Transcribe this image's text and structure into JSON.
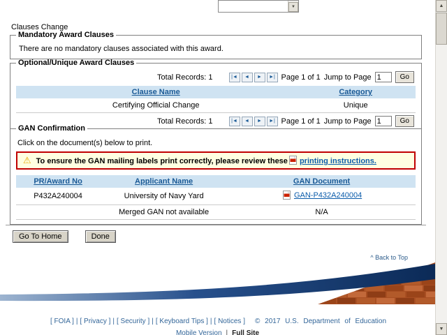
{
  "page": {
    "section_label": "Clauses Change",
    "back_to_top": "^ Back to Top"
  },
  "icons": {
    "scroll_up": "▲",
    "scroll_down": "▼",
    "warning": "⚠"
  },
  "mandatory": {
    "legend": "Mandatory Award Clauses",
    "empty_message": "There are no mandatory clauses associated with this award."
  },
  "optional": {
    "legend": "Optional/Unique Award Clauses",
    "pagination": {
      "total_label": "Total Records: 1",
      "first": "|◄",
      "prev": "◄",
      "next": "►",
      "last": "►|",
      "page_label": "Page 1 of 1",
      "jump_label": "Jump to Page",
      "jump_value": "1",
      "go": "Go"
    },
    "table": {
      "col1": "Clause Name",
      "col2": "Category",
      "rows": [
        {
          "clause": "Certifying Official Change",
          "category": "Unique"
        }
      ]
    }
  },
  "gan": {
    "legend": "GAN Confirmation",
    "instruction": "Click on the document(s) below to print.",
    "warning_before": "To ensure the GAN mailing labels print correctly, please review these",
    "warning_link": "printing instructions.",
    "table": {
      "col1": "PR/Award No",
      "col2": "Applicant Name",
      "col3": "GAN Document",
      "rows": [
        {
          "pr_award_no": "P432A240004",
          "applicant_name": "University of Navy Yard",
          "gan_document": "GAN-P432A240004"
        },
        {
          "pr_award_no": "",
          "applicant_name": "Merged GAN not available",
          "gan_document": "N/A"
        }
      ]
    }
  },
  "actions": {
    "go_to_home": "Go To Home",
    "done": "Done"
  },
  "footer": {
    "links": [
      "[ FOIA ]",
      "[ Privacy ]",
      "[ Security ]",
      "[ Keyboard Tips ]",
      "[ Notices ]"
    ],
    "separator": "|",
    "copyright": "© 2017 U.S. Department of Education",
    "mobile_version": "Mobile Version",
    "full_site": "Full Site"
  },
  "colors": {
    "table_header_bg": "#cfe3f2",
    "table_header_text": "#1a5a96",
    "warning_border": "#c00000",
    "warning_bg": "#ffffe1",
    "link": "#0b5cab",
    "footer_link": "#336699",
    "swoosh_navy": "#0b2a57",
    "brick_orange": "#a84e22"
  }
}
